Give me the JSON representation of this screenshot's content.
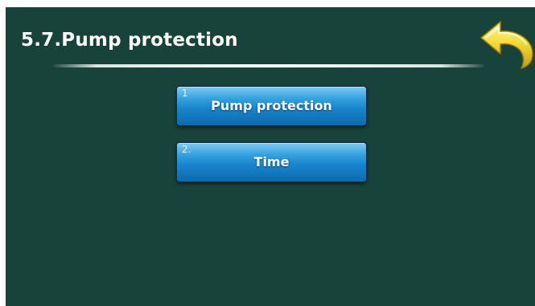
{
  "header": {
    "title": "5.7.Pump protection",
    "back_icon": "back-arrow-icon"
  },
  "menu": {
    "items": [
      {
        "number": "1",
        "label": "Pump protection"
      },
      {
        "number": "2.",
        "label": "Time"
      }
    ]
  },
  "colors": {
    "background": "#18433a",
    "button": "#1a86cd",
    "back_arrow": "#f2d431",
    "text": "#ffffff"
  }
}
